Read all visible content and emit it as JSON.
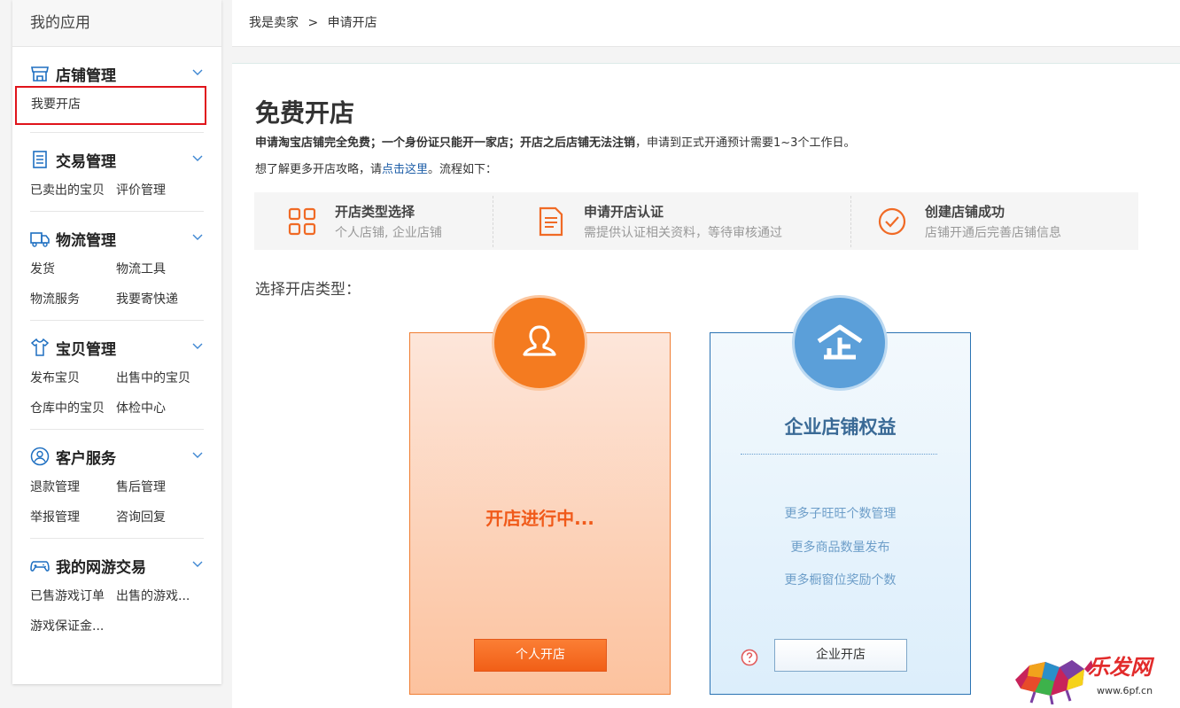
{
  "sidebar": {
    "title": "我的应用",
    "sections": [
      {
        "title": "店铺管理",
        "icon": "shop-icon",
        "links": [
          "我要开店"
        ]
      },
      {
        "title": "交易管理",
        "icon": "receipt-icon",
        "links": [
          "已卖出的宝贝",
          "评价管理"
        ]
      },
      {
        "title": "物流管理",
        "icon": "truck-icon",
        "links": [
          "发货",
          "物流工具",
          "物流服务",
          "我要寄快递"
        ]
      },
      {
        "title": "宝贝管理",
        "icon": "shirt-icon",
        "links": [
          "发布宝贝",
          "出售中的宝贝",
          "仓库中的宝贝",
          "体检中心"
        ]
      },
      {
        "title": "客户服务",
        "icon": "user-circle-icon",
        "links": [
          "退款管理",
          "售后管理",
          "举报管理",
          "咨询回复"
        ]
      },
      {
        "title": "我的网游交易",
        "icon": "gamepad-icon",
        "links": [
          "已售游戏订单",
          "出售的游戏...",
          "游戏保证金..."
        ]
      }
    ]
  },
  "breadcrumb": {
    "part1": "我是卖家",
    "sep": ">",
    "part2": "申请开店"
  },
  "main": {
    "title": "免费开店",
    "desc_bold1": "申请淘宝店铺完全免费；一个身份证只能开一家店；开店之后店铺无法注销",
    "desc_rest1": "，申请到正式开通预计需要1~3个工作日。",
    "desc2_pre": "想了解更多开店攻略，请",
    "desc2_link": "点击这里",
    "desc2_post": "。流程如下：",
    "steps": [
      {
        "title": "开店类型选择",
        "sub": "个人店铺, 企业店铺",
        "icon": "grid-icon"
      },
      {
        "title": "申请开店认证",
        "sub": "需提供认证相关资料，等待审核通过",
        "icon": "document-icon"
      },
      {
        "title": "创建店铺成功",
        "sub": "店铺开通后完善店铺信息",
        "icon": "check-circle-icon"
      }
    ],
    "choose_label": "选择开店类型：",
    "personal": {
      "status": "开店进行中...",
      "button": "个人开店"
    },
    "enterprise": {
      "title": "企业店铺权益",
      "benefits": [
        "更多子旺旺个数管理",
        "更多商品数量发布",
        "更多橱窗位奖励个数"
      ],
      "button": "企业开店"
    }
  },
  "watermark": {
    "text": "乐发网",
    "url": "www.6pf.cn"
  },
  "colors": {
    "accent_orange": "#f47b20",
    "accent_blue": "#5b9fd9",
    "active_border": "#e0141b",
    "link_blue": "#1f5fa8"
  }
}
